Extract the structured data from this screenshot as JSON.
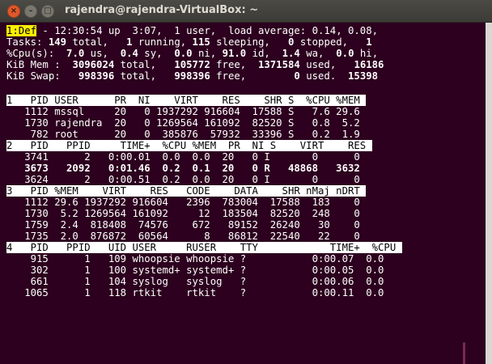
{
  "window": {
    "title": "rajendra@rajendra-VirtualBox: ~",
    "close_glyph": "×",
    "minimize_glyph": "–",
    "maximize_glyph": "□"
  },
  "summary": {
    "def_label": "1:Def",
    "line1_rest": " - 12:30:54 up  3:07,  1 user,  load average: 0.14, 0.08,",
    "line2": [
      {
        "t": "Tasks: "
      },
      {
        "t": "149",
        "b": true
      },
      {
        "t": " total,   "
      },
      {
        "t": "1",
        "b": true
      },
      {
        "t": " running, "
      },
      {
        "t": "115",
        "b": true
      },
      {
        "t": " sleeping,   "
      },
      {
        "t": "0",
        "b": true
      },
      {
        "t": " stopped,   "
      },
      {
        "t": "1",
        "b": true
      }
    ],
    "line3": [
      {
        "t": "%Cpu(s):  "
      },
      {
        "t": "7.0",
        "b": true
      },
      {
        "t": " us,  "
      },
      {
        "t": "0.4",
        "b": true
      },
      {
        "t": " sy,  "
      },
      {
        "t": "0.0",
        "b": true
      },
      {
        "t": " ni, "
      },
      {
        "t": "91.0",
        "b": true
      },
      {
        "t": " id,  "
      },
      {
        "t": "1.4",
        "b": true
      },
      {
        "t": " wa,  "
      },
      {
        "t": "0.0",
        "b": true
      },
      {
        "t": " hi,"
      }
    ],
    "line4": [
      {
        "t": "KiB Mem :  "
      },
      {
        "t": "3096024",
        "b": true
      },
      {
        "t": " total,   "
      },
      {
        "t": "105772",
        "b": true
      },
      {
        "t": " free,  "
      },
      {
        "t": "1371584",
        "b": true
      },
      {
        "t": " used,   "
      },
      {
        "t": "16186",
        "b": true
      }
    ],
    "line5": [
      {
        "t": "KiB Swap:   "
      },
      {
        "t": "998396",
        "b": true
      },
      {
        "t": " total,   "
      },
      {
        "t": "998396",
        "b": true
      },
      {
        "t": " free,        "
      },
      {
        "t": "0",
        "b": true
      },
      {
        "t": " used.  "
      },
      {
        "t": "15398",
        "b": true
      }
    ]
  },
  "window1": {
    "header": "1   PID USER      PR  NI    VIRT    RES    SHR S  %CPU %MEM ",
    "rows": [
      {
        "text": "   1112 mssql     20   0 1937292 916604  17588 S   7.6 29.6",
        "bold": false
      },
      {
        "text": "   1730 rajendra  20   0 1269564 161092  82520 S   0.8  5.2",
        "bold": false
      },
      {
        "text": "    782 root      20   0  385876  57932  33396 S   0.2  1.9",
        "bold": false
      }
    ]
  },
  "window2": {
    "header": "2   PID   PPID     TIME+  %CPU %MEM  PR  NI S    VIRT    RES ",
    "rows": [
      {
        "text": "   3741      2   0:00.01  0.0  0.0  20   0 I       0      0",
        "bold": false
      },
      {
        "text": "   3673   2092   0:01.46  0.2  0.1  20   0 R   48868   3632",
        "bold": true
      },
      {
        "text": "   3624      2   0:00.51  0.2  0.0  20   0 I       0      0",
        "bold": false
      }
    ]
  },
  "window3": {
    "header": "3   PID %MEM    VIRT    RES   CODE    DATA    SHR nMaj nDRT ",
    "rows": [
      {
        "text": "   1112 29.6 1937292 916604   2396  783004  17588  183    0",
        "bold": false
      },
      {
        "text": "   1730  5.2 1269564 161092     12  183504  82520  248    0",
        "bold": false
      },
      {
        "text": "   1759  2.4  818408  74576    672   89152  26240   30    0",
        "bold": false
      },
      {
        "text": "   1735  2.0  876872  60564      8   86812  22540   22    0",
        "bold": false
      }
    ]
  },
  "window4": {
    "header": "4   PID   PPID   UID USER     RUSER    TTY            TIME+  %CPU ",
    "rows": [
      {
        "text": "    915      1   109 whoopsie whoopsie ?           0:00.07  0.0",
        "bold": false
      },
      {
        "text": "    302      1   100 systemd+ systemd+ ?           0:00.05  0.0",
        "bold": false
      },
      {
        "text": "    661      1   104 syslog   syslog   ?           0:00.06  0.0",
        "bold": false
      },
      {
        "text": "   1065      1   118 rtkit    rtkit    ?           0:00.11  0.0",
        "bold": false
      }
    ]
  }
}
